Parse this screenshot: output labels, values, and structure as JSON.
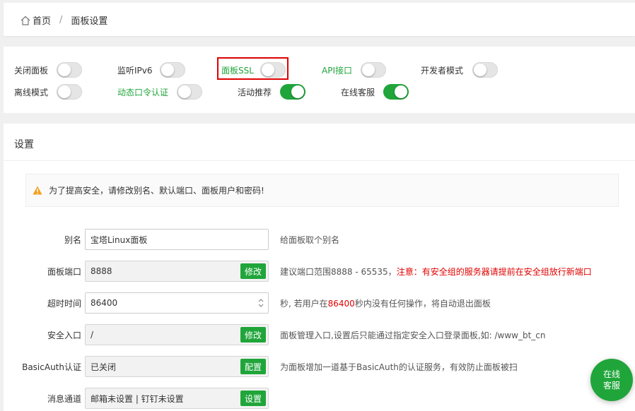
{
  "breadcrumb": {
    "home": "首页",
    "separator": "/",
    "current": "面板设置"
  },
  "toggles": [
    {
      "label": "关闭面板",
      "on": false,
      "green": false
    },
    {
      "label": "监听IPv6",
      "on": false,
      "green": false
    },
    {
      "label": "面板SSL",
      "on": false,
      "green": true,
      "highlighted": true
    },
    {
      "label": "API接口",
      "on": false,
      "green": true
    },
    {
      "label": "开发者模式",
      "on": false,
      "green": false
    },
    {
      "label": "离线模式",
      "on": false,
      "green": false
    },
    {
      "label": "动态口令认证",
      "on": false,
      "green": true
    },
    {
      "label": "活动推荐",
      "on": true,
      "green": false
    },
    {
      "label": "在线客服",
      "on": true,
      "green": false
    }
  ],
  "settings": {
    "title": "设置",
    "alert": "为了提高安全，请修改别名、默认端口、面板用户和密码!",
    "rows": [
      {
        "label": "别名",
        "value": "宝塔Linux面板",
        "button": null,
        "hint": "给面板取个别名"
      },
      {
        "label": "面板端口",
        "value": "8888",
        "button": "修改",
        "hint": "建议端口范围8888 - 65535，",
        "hint_warn": "注意：有安全组的服务器请提前在安全组放行新端口"
      },
      {
        "label": "超时时间",
        "value": "86400",
        "button": null,
        "hint": "秒, 若用户在",
        "hint_red": "86400",
        "hint_after": "秒内没有任何操作，将自动退出面板"
      },
      {
        "label": "安全入口",
        "value": "/",
        "button": "修改",
        "hint": "面板管理入口,设置后只能通过指定安全入口登录面板,如: /www_bt_cn"
      },
      {
        "label": "BasicAuth认证",
        "value": "已关闭",
        "button": "配置",
        "hint": "为面板增加一道基于BasicAuth的认证服务，有效防止面板被扫"
      },
      {
        "label": "消息通道",
        "value": "邮箱未设置 | 钉钉未设置",
        "button": "设置",
        "hint": ""
      }
    ]
  },
  "chat": {
    "line1": "在线",
    "line2": "客服"
  },
  "colors": {
    "accent": "#20a53a",
    "warning": "#e00000",
    "highlight_border": "#e00000"
  },
  "icons": {
    "home": "home-icon",
    "warning": "warning-triangle-icon",
    "spinner": "number-spinner-icon"
  }
}
